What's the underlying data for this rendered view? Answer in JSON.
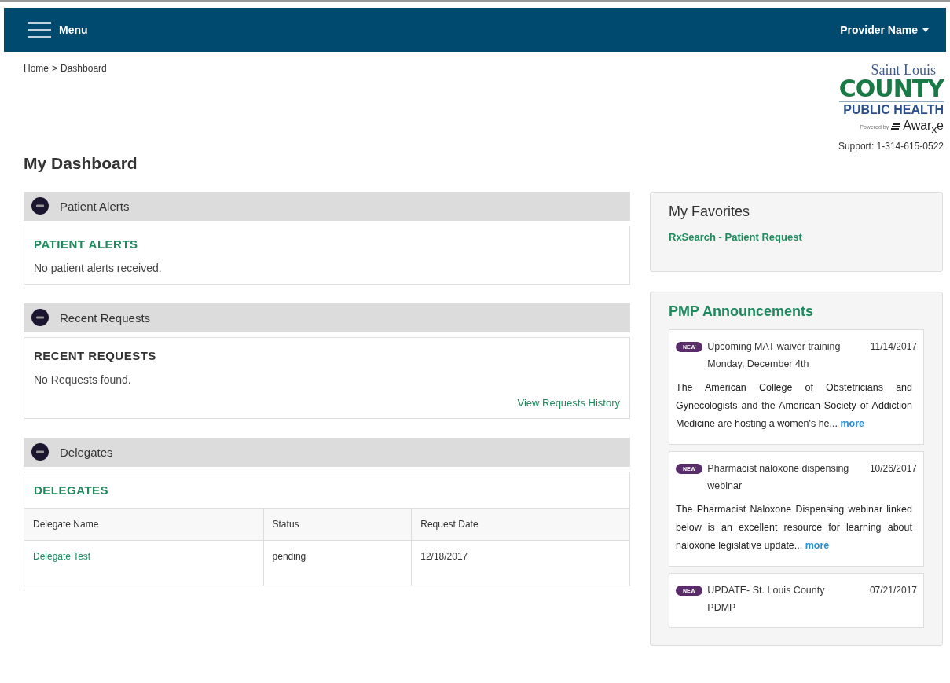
{
  "header": {
    "menu_label": "Menu",
    "user_name": "Provider Name"
  },
  "breadcrumb": [
    {
      "label": "Home"
    },
    {
      "label": "Dashboard"
    }
  ],
  "breadcrumb_separator": ">",
  "logo": {
    "line_1": "Saint Louis",
    "line_2": "COUNTY",
    "line_3": "PUBLIC HEALTH",
    "powered_by": "Powered by",
    "brand": "Awar$_{x}$e"
  },
  "support": "Support: 1-314-615-0522",
  "page_title": "My Dashboard",
  "panels": [
    {
      "header": "Patient Alerts",
      "expanded": true,
      "title": "PATIENT ALERTS",
      "color": "#1e8a5e",
      "message": "No patient alerts received."
    },
    {
      "header": "Recent Requests",
      "expanded": true,
      "title": "RECENT REQUESTS",
      "color": "#333333",
      "message": "No Requests found.",
      "link": "View Requests History"
    },
    {
      "header": "Delegates",
      "expanded": true,
      "title": "DELEGATES",
      "color": "#1e8a5e",
      "table": {
        "columns": [
          "Delegate Name",
          "Status",
          "Request Date"
        ],
        "rows": [
          [
            "Delegate Test",
            "pending",
            "12/18/2017"
          ]
        ]
      }
    }
  ],
  "favorites": {
    "title": "My Favorites",
    "items": [
      "RxSearch - Patient Request"
    ]
  },
  "announcements": {
    "title": "PMP Announcements",
    "items": [
      {
        "badge": "NEW",
        "title": "Upcoming MAT waiver training Monday, December 4th",
        "date": "11/14/2017",
        "body": "The American College of Obstetricians and Gynecologists and the American Society of Addiction Medicine are hosting a women's he...",
        "more": "more"
      },
      {
        "badge": "NEW",
        "title": "Pharmacist naloxone dispensing webinar",
        "date": "10/26/2017",
        "body": "The Pharmacist Naloxone Dispensing webinar linked below is an excellent resource for learning about naloxone legislative update...",
        "more": "more"
      },
      {
        "badge": "NEW",
        "title": "UPDATE- St. Louis County PDMP",
        "date": "07/21/2017"
      }
    ]
  }
}
